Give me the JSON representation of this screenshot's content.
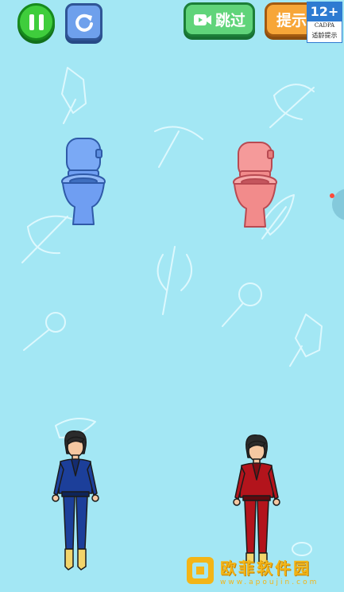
{
  "toolbar": {
    "skip_label": "跳过",
    "hint_label": "提示"
  },
  "age_badge": {
    "rating": "12+",
    "org": "CADPA",
    "caption": "适龄提示"
  },
  "scene": {
    "toilets": [
      {
        "name": "blue-toilet",
        "color": "#6f9ef2"
      },
      {
        "name": "pink-toilet",
        "color": "#f28b8b"
      }
    ],
    "characters": [
      {
        "name": "woman-blue-suit",
        "color": "#1c3f9a"
      },
      {
        "name": "woman-red-suit",
        "color": "#b3141c"
      }
    ]
  },
  "watermark": {
    "title": "欧菲软件园",
    "url": "www.apoujin.com"
  },
  "colors": {
    "background": "#a3e7f4",
    "pause": "#3fcd3c",
    "restart": "#6ea0ec",
    "skip": "#60d47a",
    "hint": "#f7a638"
  }
}
